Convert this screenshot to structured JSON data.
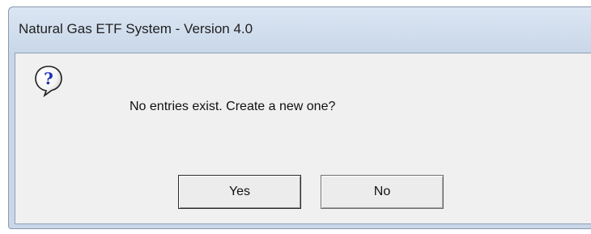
{
  "window": {
    "title": "Natural Gas ETF System - Version 4.0"
  },
  "dialog": {
    "icon": "question-icon",
    "message": "No entries exist.  Create a new one?",
    "buttons": {
      "yes_label": "Yes",
      "no_label": "No"
    }
  }
}
